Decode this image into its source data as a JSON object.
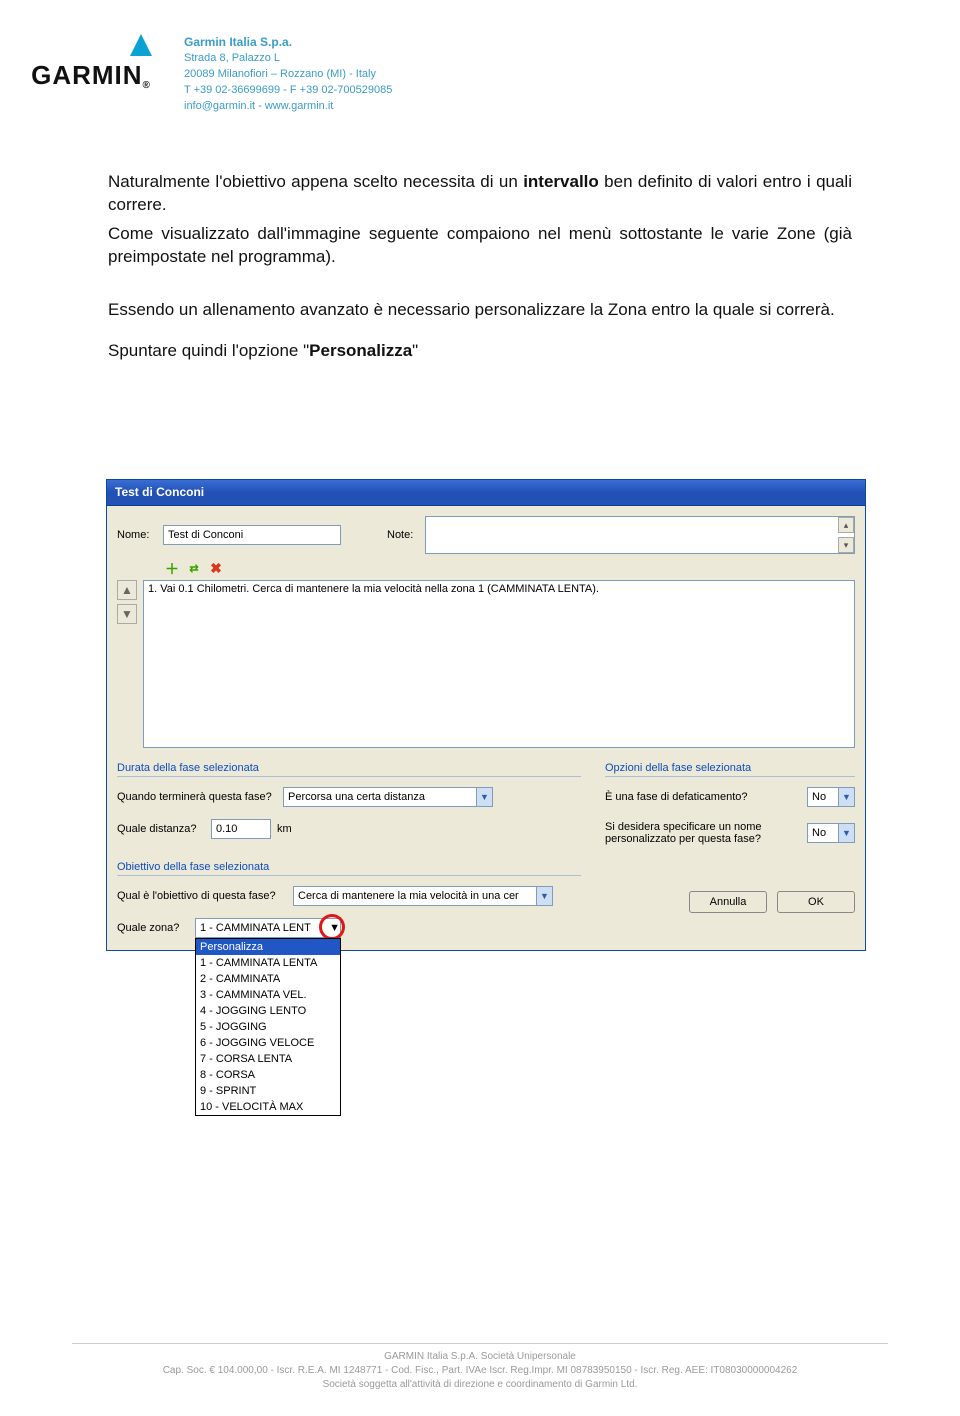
{
  "company": {
    "name": "Garmin Italia S.p.a.",
    "addr1": "Strada 8, Palazzo L",
    "addr2": "20089 Milanofiori – Rozzano (MI) - Italy",
    "tel": "T +39 02-36699699 - F +39 02-700529085",
    "web": "info@garmin.it - www.garmin.it"
  },
  "logo_text": "GARMIN",
  "para": {
    "p1a": "Naturalmente l'obiettivo appena scelto necessita di un ",
    "p1b": "intervallo",
    "p1c": " ben definito di valori entro i quali correre.",
    "p2": "Come visualizzato dall'immagine seguente compaiono nel menù sottostante le varie Zone (già preimpostate nel programma).",
    "p3": "Essendo un allenamento avanzato è necessario personalizzare la Zona entro la quale si correrà.",
    "p4a": "Spuntare quindi l'opzione \"",
    "p4b": "Personalizza",
    "p4c": "\""
  },
  "dialog": {
    "title": "Test di Conconi",
    "nome_label": "Nome:",
    "nome_value": "Test di Conconi",
    "note_label": "Note:",
    "step1": "1. Vai 0.1 Chilometri. Cerca di mantenere la mia velocità nella zona 1 (CAMMINATA LENTA).",
    "durata_section": "Durata della fase selezionata",
    "q_termina": "Quando terminerà questa fase?",
    "termina_value": "Percorsa una certa distanza",
    "q_distanza": "Quale distanza?",
    "distanza_value": "0.10",
    "distanza_unit": "km",
    "obiettivo_section": "Obiettivo della fase selezionata",
    "q_obiettivo": "Qual è l'obiettivo di questa fase?",
    "obiettivo_value": "Cerca di mantenere la mia velocità in una cer",
    "q_zona": "Quale zona?",
    "zona_value": "1 - CAMMINATA LENT",
    "opzioni_section": "Opzioni della fase selezionata",
    "q_defat": "È una fase di defaticamento?",
    "defat_value": "No",
    "q_nomepers": "Si desidera specificare un nome personalizzato per questa fase?",
    "nomepers_value": "No",
    "annulla": "Annulla",
    "ok": "OK"
  },
  "dropdown": [
    "Personalizza",
    "1 - CAMMINATA LENTA",
    "2 - CAMMINATA",
    "3 - CAMMINATA VEL.",
    "4 - JOGGING LENTO",
    "5 - JOGGING",
    "6 - JOGGING VELOCE",
    "7 - CORSA LENTA",
    "8 - CORSA",
    "9 - SPRINT",
    "10 - VELOCITÀ MAX"
  ],
  "footer": {
    "l1": "GARMIN Italia S.p.A. Società Unipersonale",
    "l2": "Cap. Soc. € 104.000,00  -  Iscr. R.E.A. MI 1248771 -  Cod. Fisc., Part. IVAe Iscr. Reg.Impr. MI 08783950150 - Iscr. Reg. AEE: IT08030000004262",
    "l3": "Società soggetta all'attività di direzione e coordinamento di Garmin Ltd."
  }
}
